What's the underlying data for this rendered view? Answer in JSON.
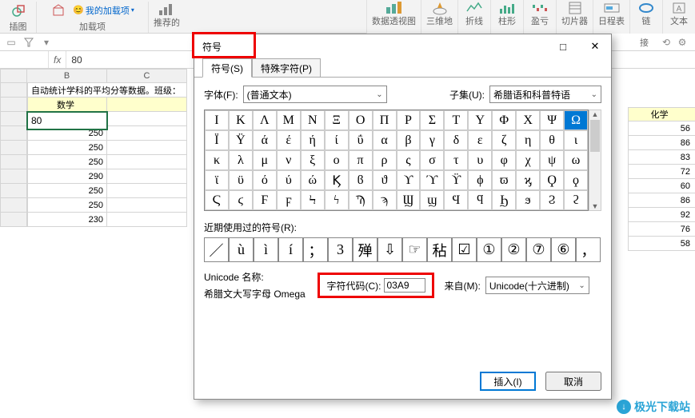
{
  "ribbon": {
    "insert_pic": "插图",
    "addins": "加载项",
    "my_addins": "我的加载项",
    "recommended": "推荐的",
    "pivot": "数据透视图",
    "threed": "三维地",
    "line": "折线",
    "column": "柱形",
    "winloss": "盈亏",
    "slicer": "切片器",
    "timeline": "日程表",
    "link": "链",
    "text": "文本",
    "connect": "接"
  },
  "dialog": {
    "title": "符号",
    "tab_symbol": "符号(S)",
    "tab_special": "特殊字符(P)",
    "font_label": "字体(F):",
    "font_value": "(普通文本)",
    "subset_label": "子集(U):",
    "subset_value": "希腊语和科普特语",
    "recent_label": "近期使用过的符号(R):",
    "unicode_label": "Unicode 名称:",
    "unicode_name": "希腊文大写字母 Omega",
    "charcode_label": "字符代码(C):",
    "charcode_value": "03A9",
    "from_label": "来自(M):",
    "from_value": "Unicode(十六进制)",
    "insert_btn": "插入(I)",
    "cancel_btn": "取消"
  },
  "chars": [
    "Ι",
    "Κ",
    "Λ",
    "Μ",
    "Ν",
    "Ξ",
    "Ο",
    "Π",
    "Ρ",
    "Σ",
    "Τ",
    "Υ",
    "Φ",
    "Χ",
    "Ψ",
    "Ω",
    "Ϊ",
    "Ϋ",
    "ά",
    "έ",
    "ή",
    "ί",
    "ΰ",
    "α",
    "β",
    "γ",
    "δ",
    "ε",
    "ζ",
    "η",
    "θ",
    "ι",
    "κ",
    "λ",
    "μ",
    "ν",
    "ξ",
    "ο",
    "π",
    "ρ",
    "ς",
    "σ",
    "τ",
    "υ",
    "φ",
    "χ",
    "ψ",
    "ω",
    "ϊ",
    "ϋ",
    "ό",
    "ύ",
    "ώ",
    "Ϗ",
    "ϐ",
    "ϑ",
    "ϒ",
    "ϓ",
    "ϔ",
    "ϕ",
    "ϖ",
    "ϗ",
    "Ϙ",
    "ϙ",
    "Ϛ",
    "ϛ",
    "Ϝ",
    "ϝ",
    "Ϟ",
    "ϟ",
    "Ϡ",
    "ϡ",
    "Ϣ",
    "ϣ",
    "Ϥ",
    "ϥ",
    "Ϧ",
    "ϧ",
    "Ϩ",
    "ϩ"
  ],
  "recent": [
    "／",
    "ù",
    "ì",
    "í",
    "；",
    "3",
    "殚",
    "⇩",
    "☞",
    "秥",
    "☑",
    "①",
    "②",
    "⑦",
    "⑥",
    "，"
  ],
  "sheet": {
    "header_text": "自动统计学科的平均分等数据。班级：",
    "col_math": "数学",
    "col_chem": "化学",
    "colB_vals": [
      "80",
      "250",
      "250",
      "250",
      "290",
      "250",
      "250",
      "230"
    ],
    "right_vals": [
      "56",
      "86",
      "83",
      "72",
      "60",
      "86",
      "92",
      "76",
      "58"
    ],
    "colB_letter": "B",
    "colC_letter": "C",
    "fx": "80"
  },
  "fx_symbol": "fx"
}
